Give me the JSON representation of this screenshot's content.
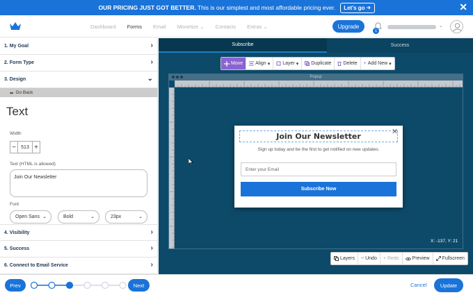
{
  "banner": {
    "message_bold": "OUR PRICING JUST GOT BETTER.",
    "message": "This is our simplest and most affordable pricing ever.",
    "cta": "Let's go",
    "close": "✕"
  },
  "nav": {
    "items": [
      "Dashboard",
      "Forms",
      "Email",
      "Monetize",
      "Contacts",
      "Extras"
    ],
    "upgrade": "Upgrade",
    "notification_count": "1"
  },
  "sidebar": {
    "sections": {
      "goal": "1. My Goal",
      "formtype": "2. Form Type",
      "design": "3. Design",
      "visibility": "4. Visibility",
      "success": "5. Success",
      "connect": "6. Connect to Email Service"
    },
    "go_back": "Go Back",
    "panel_title": "Text",
    "width_label": "Width",
    "width_value": "513",
    "minus": "−",
    "plus": "+",
    "html_label": "Text (HTML is allowed)",
    "html_value": "Join Our Newsletter",
    "font_label": "Font",
    "font_family": "Open Sans",
    "font_weight": "Bold",
    "font_size": "23px"
  },
  "footer": {
    "prev": "Prev",
    "next": "Next",
    "cancel": "Cancel",
    "update": "Update",
    "step_count": 6,
    "current_step": 3
  },
  "canvas": {
    "tabs": [
      "Subscribe",
      "Success"
    ],
    "toolbar": [
      "Move",
      "Align",
      "Layer",
      "Duplicate",
      "Delete",
      "Add New"
    ],
    "window_title": "Popup",
    "coords": "X: -137, Y: 21",
    "bottom_toolbar": [
      "Layers",
      "Undo",
      "Redo",
      "Preview",
      "Fullscreen"
    ]
  },
  "popup": {
    "title": "Join Our Newsletter",
    "subtitle": "Sign up today and be the first to get notified on new updates.",
    "email_placeholder": "Enter your Email",
    "button": "Subscribe Now",
    "close": "✕"
  },
  "colors": {
    "primary": "#1a73d9",
    "canvas": "#0d4a6a",
    "move_active": "#8a63d2",
    "heading": "#1f3650"
  }
}
